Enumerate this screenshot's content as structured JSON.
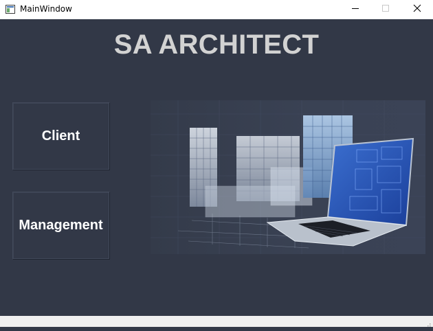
{
  "window": {
    "title": "MainWindow",
    "controls": [
      "minimize",
      "maximize",
      "close"
    ]
  },
  "app": {
    "title": "SA ARCHITECT"
  },
  "buttons": {
    "client": "Client",
    "management": "Management"
  },
  "icons": {
    "app": "app-window-icon",
    "minimize": "minimize-icon",
    "maximize": "maximize-icon",
    "close": "close-icon",
    "resize": "resize-grip-icon"
  },
  "colors": {
    "background": "#323847",
    "title_text": "#d2d2d2",
    "button_text": "#ffffff",
    "titlebar": "#ffffff",
    "statusbar": "#f0f0f0"
  },
  "hero_image": {
    "subject": "wireframe buildings with laptop"
  }
}
